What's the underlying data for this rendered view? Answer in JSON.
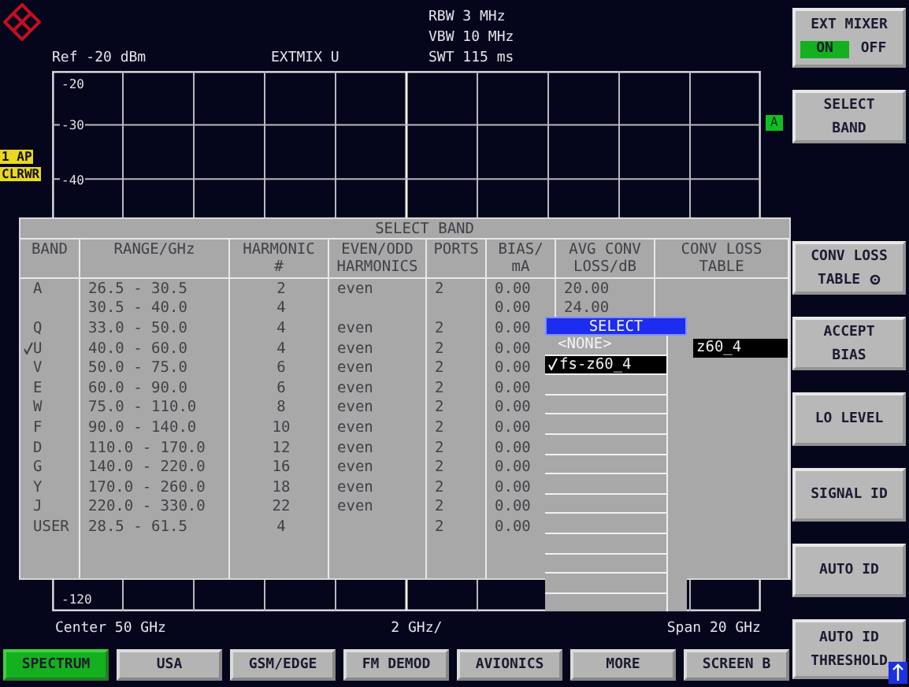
{
  "header": {
    "ref_level": "Ref -20 dBm",
    "mixer": "EXTMIX U",
    "settings": [
      "RBW 3 MHz",
      "VBW 10 MHz",
      "SWT 115 ms"
    ]
  },
  "trace_labels": [
    "1 AP",
    "CLRWR"
  ],
  "graph": {
    "upper_labels": [
      "-20",
      "-30",
      "-40"
    ],
    "bottom_label": "-120",
    "trace_marker": "A"
  },
  "footer": {
    "center": "Center 50 GHz",
    "division": "2 GHz/",
    "span": "Span 20 GHz"
  },
  "dialog": {
    "title": "SELECT BAND",
    "columns": [
      [
        "BAND"
      ],
      [
        "RANGE/GHz"
      ],
      [
        "HARMONIC",
        "#"
      ],
      [
        "EVEN/ODD",
        "HARMONICS"
      ],
      [
        "PORTS"
      ],
      [
        "BIAS/",
        "mA"
      ],
      [
        "AVG CONV",
        "LOSS/dB"
      ],
      [
        "CONV LOSS",
        "TABLE"
      ]
    ],
    "rows": [
      {
        "band": "A",
        "range": "26.5 - 30.5",
        "harmonic": "2",
        "parity": "even",
        "ports": "2",
        "bias": "0.00",
        "avg_loss": "20.00",
        "selected": false
      },
      {
        "range": "30.5 - 40.0",
        "harmonic": "4",
        "bias": "0.00",
        "avg_loss": "24.00",
        "selected": false
      },
      {
        "band": "Q",
        "range": "33.0 - 50.0",
        "harmonic": "4",
        "parity": "even",
        "ports": "2",
        "bias": "0.00",
        "selected": false
      },
      {
        "band": "U",
        "range": "40.0 - 60.0",
        "harmonic": "4",
        "parity": "even",
        "ports": "2",
        "bias": "0.00",
        "loss_table": "z60_4",
        "selected": true
      },
      {
        "band": "V",
        "range": "50.0 - 75.0",
        "harmonic": "6",
        "parity": "even",
        "ports": "2",
        "bias": "0.00",
        "selected": false
      },
      {
        "band": "E",
        "range": "60.0 - 90.0",
        "harmonic": "6",
        "parity": "even",
        "ports": "2",
        "bias": "0.00",
        "selected": false
      },
      {
        "band": "W",
        "range": "75.0 - 110.0",
        "harmonic": "8",
        "parity": "even",
        "ports": "2",
        "bias": "0.00",
        "selected": false
      },
      {
        "band": "F",
        "range": "90.0 - 140.0",
        "harmonic": "10",
        "parity": "even",
        "ports": "2",
        "bias": "0.00",
        "selected": false
      },
      {
        "band": "D",
        "range": "110.0 - 170.0",
        "harmonic": "12",
        "parity": "even",
        "ports": "2",
        "bias": "0.00",
        "selected": false
      },
      {
        "band": "G",
        "range": "140.0 - 220.0",
        "harmonic": "16",
        "parity": "even",
        "ports": "2",
        "bias": "0.00",
        "selected": false
      },
      {
        "band": "Y",
        "range": "170.0 - 260.0",
        "harmonic": "18",
        "parity": "even",
        "ports": "2",
        "bias": "0.00",
        "selected": false
      },
      {
        "band": "J",
        "range": "220.0 - 330.0",
        "harmonic": "22",
        "parity": "even",
        "ports": "2",
        "bias": "0.00",
        "selected": false
      },
      {
        "band": "USER",
        "range": "28.5 - 61.5",
        "harmonic": "4",
        "ports": "2",
        "bias": "0.00",
        "selected": false
      }
    ]
  },
  "popup": {
    "title": "SELECT",
    "items": [
      {
        "label": "<NONE>",
        "selected": false
      },
      {
        "label": "fs-z60_4",
        "selected": true
      }
    ]
  },
  "softkeys": [
    {
      "kind": "toggle",
      "lines": [
        "EXT MIXER"
      ],
      "options": [
        {
          "label": "ON",
          "selected": true
        },
        {
          "label": "OFF",
          "selected": false
        }
      ]
    },
    {
      "kind": "button",
      "lines": [
        "SELECT",
        "BAND"
      ]
    },
    {
      "kind": "empty"
    },
    {
      "kind": "submenu",
      "lines": [
        "CONV LOSS",
        "TABLE"
      ]
    },
    {
      "kind": "button",
      "lines": [
        "ACCEPT",
        "BIAS"
      ]
    },
    {
      "kind": "button",
      "lines": [
        "LO LEVEL"
      ]
    },
    {
      "kind": "button",
      "lines": [
        "SIGNAL ID"
      ]
    },
    {
      "kind": "button",
      "lines": [
        "AUTO ID"
      ]
    },
    {
      "kind": "button",
      "lines": [
        "AUTO ID",
        "THRESHOLD"
      ]
    }
  ],
  "hotkeys": [
    {
      "label": "SPECTRUM",
      "selected": true
    },
    {
      "label": "USA",
      "selected": false
    },
    {
      "label": "GSM/EDGE",
      "selected": false
    },
    {
      "label": "FM DEMOD",
      "selected": false
    },
    {
      "label": "AVIONICS",
      "selected": false
    },
    {
      "label": "MORE",
      "selected": false
    },
    {
      "label": "SCREEN B",
      "selected": false
    }
  ]
}
